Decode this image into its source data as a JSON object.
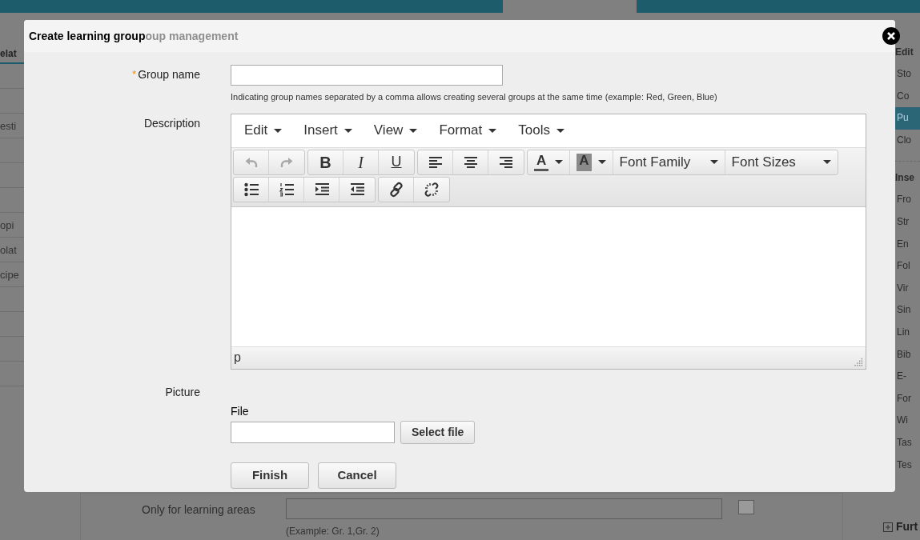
{
  "background": {
    "heading": "oup management",
    "left_panel": {
      "header": "elat",
      "rows": [
        "esti",
        "opi",
        "olat",
        "cipe"
      ]
    },
    "right_panel": {
      "sections": [
        {
          "title": "Edit",
          "items": [
            {
              "label": "Sto",
              "selected": false
            },
            {
              "label": "Co",
              "selected": false
            },
            {
              "label": "Pu",
              "selected": true
            },
            {
              "label": "Clo",
              "selected": false
            }
          ]
        },
        {
          "title": "Inse",
          "items": [
            {
              "label": "Fro",
              "selected": false
            },
            {
              "label": "Str",
              "selected": false
            },
            {
              "label": "En",
              "selected": false
            },
            {
              "label": "Fol",
              "selected": false
            },
            {
              "label": "Vir",
              "selected": false
            },
            {
              "label": "Sin",
              "selected": false
            },
            {
              "label": "Lin",
              "selected": false
            },
            {
              "label": "Bib",
              "selected": false
            },
            {
              "label": "E-",
              "selected": false
            },
            {
              "label": "For",
              "selected": false
            },
            {
              "label": "Wi",
              "selected": false
            },
            {
              "label": "Tas",
              "selected": false
            },
            {
              "label": "Tes",
              "selected": false
            }
          ]
        }
      ],
      "footer": "Furt"
    },
    "bottom": {
      "field_label": "Only for learning areas",
      "example": "(Example: Gr. 1,Gr. 2)"
    }
  },
  "dialog": {
    "title": "Create learning group",
    "fields": [
      {
        "kind": "text",
        "label": "Group name",
        "required_mark": "*",
        "hint": "Indicating group names separated by a comma allows creating several groups at the same time (example: Red, Green, Blue)"
      },
      {
        "kind": "editor",
        "label": "Description"
      },
      {
        "kind": "file",
        "label": "Picture",
        "sublabel": "File",
        "button": "Select file"
      }
    ],
    "editor": {
      "menus": [
        "Edit",
        "Insert",
        "View",
        "Format",
        "Tools"
      ],
      "toolbar_rows": [
        [
          {
            "buttons": [
              {
                "kind": "icon",
                "disabled": true
              },
              {
                "kind": "icon",
                "disabled": true
              }
            ]
          },
          {
            "buttons": [
              {
                "kind": "bold",
                "label": "B"
              },
              {
                "kind": "italic",
                "label": "I"
              },
              {
                "kind": "underline",
                "label": "U"
              }
            ]
          },
          {
            "buttons": [
              {
                "kind": "icon",
                "disabled": false
              },
              {
                "kind": "icon",
                "disabled": false
              },
              {
                "kind": "icon",
                "disabled": false
              }
            ]
          },
          {
            "buttons": [
              {
                "kind": "forecolor",
                "label": "A",
                "color": "#555555"
              },
              {
                "kind": "backcolor",
                "label": "A",
                "color": "#8a8a8a"
              },
              {
                "kind": "select",
                "label": "Font Family"
              },
              {
                "kind": "select",
                "label": "Font Sizes"
              }
            ]
          }
        ],
        [
          {
            "buttons": [
              {
                "kind": "icon",
                "disabled": false
              },
              {
                "kind": "icon",
                "disabled": false
              },
              {
                "kind": "icon",
                "disabled": false
              },
              {
                "kind": "icon",
                "disabled": false
              }
            ]
          },
          {
            "buttons": [
              {
                "kind": "icon",
                "disabled": false
              },
              {
                "kind": "icon",
                "disabled": false
              }
            ]
          }
        ]
      ],
      "status_path": "p"
    },
    "buttons": [
      "Finish",
      "Cancel"
    ]
  }
}
